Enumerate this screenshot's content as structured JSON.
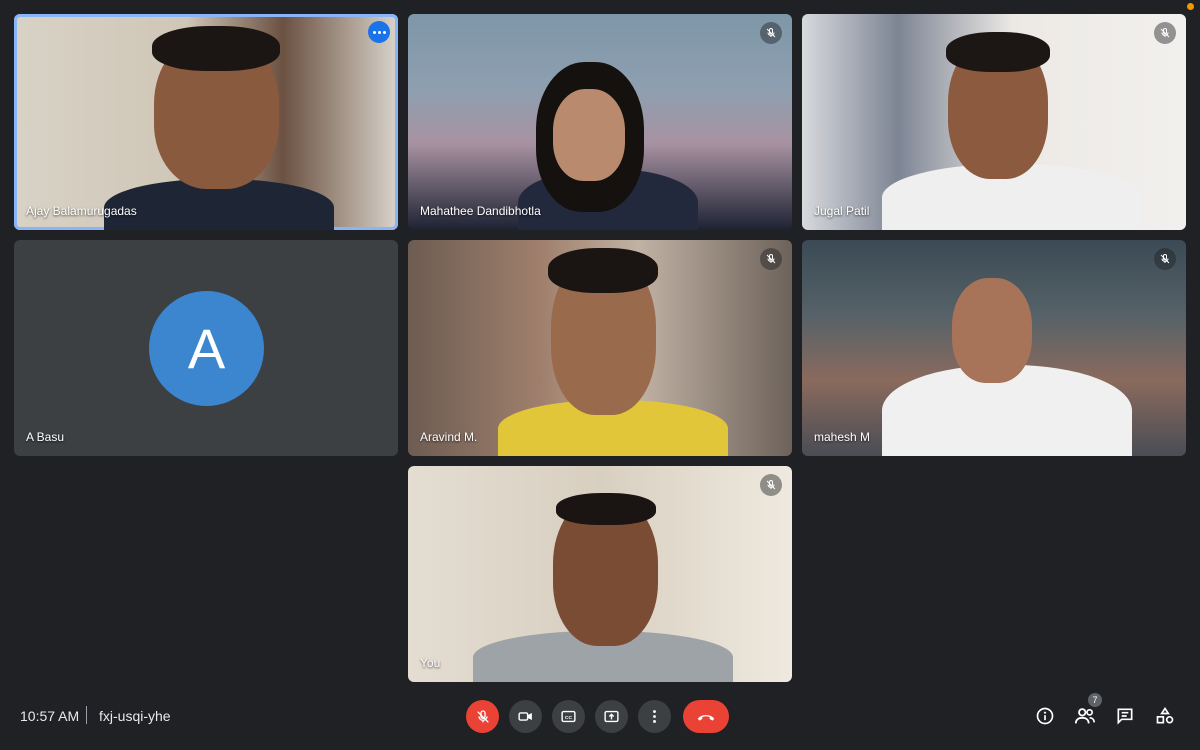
{
  "participants": [
    {
      "name": "Ajay Balamurugadas"
    },
    {
      "name": "Mahathee Dandibhotla"
    },
    {
      "name": "Jugal Patil"
    },
    {
      "name": "A Basu",
      "avatar_letter": "A"
    },
    {
      "name": "Aravind M."
    },
    {
      "name": "mahesh M"
    },
    {
      "name": "You"
    }
  ],
  "meeting": {
    "time": "10:57 AM",
    "separator": "|",
    "code": "fxj-usqi-yhe"
  },
  "people_count": "7",
  "colors": {
    "background": "#202124",
    "tile": "#3c4043",
    "active_border": "#8ab4f8",
    "hangup": "#ea4335",
    "avatar": "#3b86cf"
  },
  "icons": {
    "mic_off": "mic-off-icon",
    "camera": "camera-icon",
    "captions": "closed-captions-icon",
    "present": "present-screen-icon",
    "more": "more-vert-icon",
    "hangup": "end-call-icon",
    "info": "info-icon",
    "people": "people-icon",
    "chat": "chat-icon",
    "activities": "activities-icon"
  }
}
